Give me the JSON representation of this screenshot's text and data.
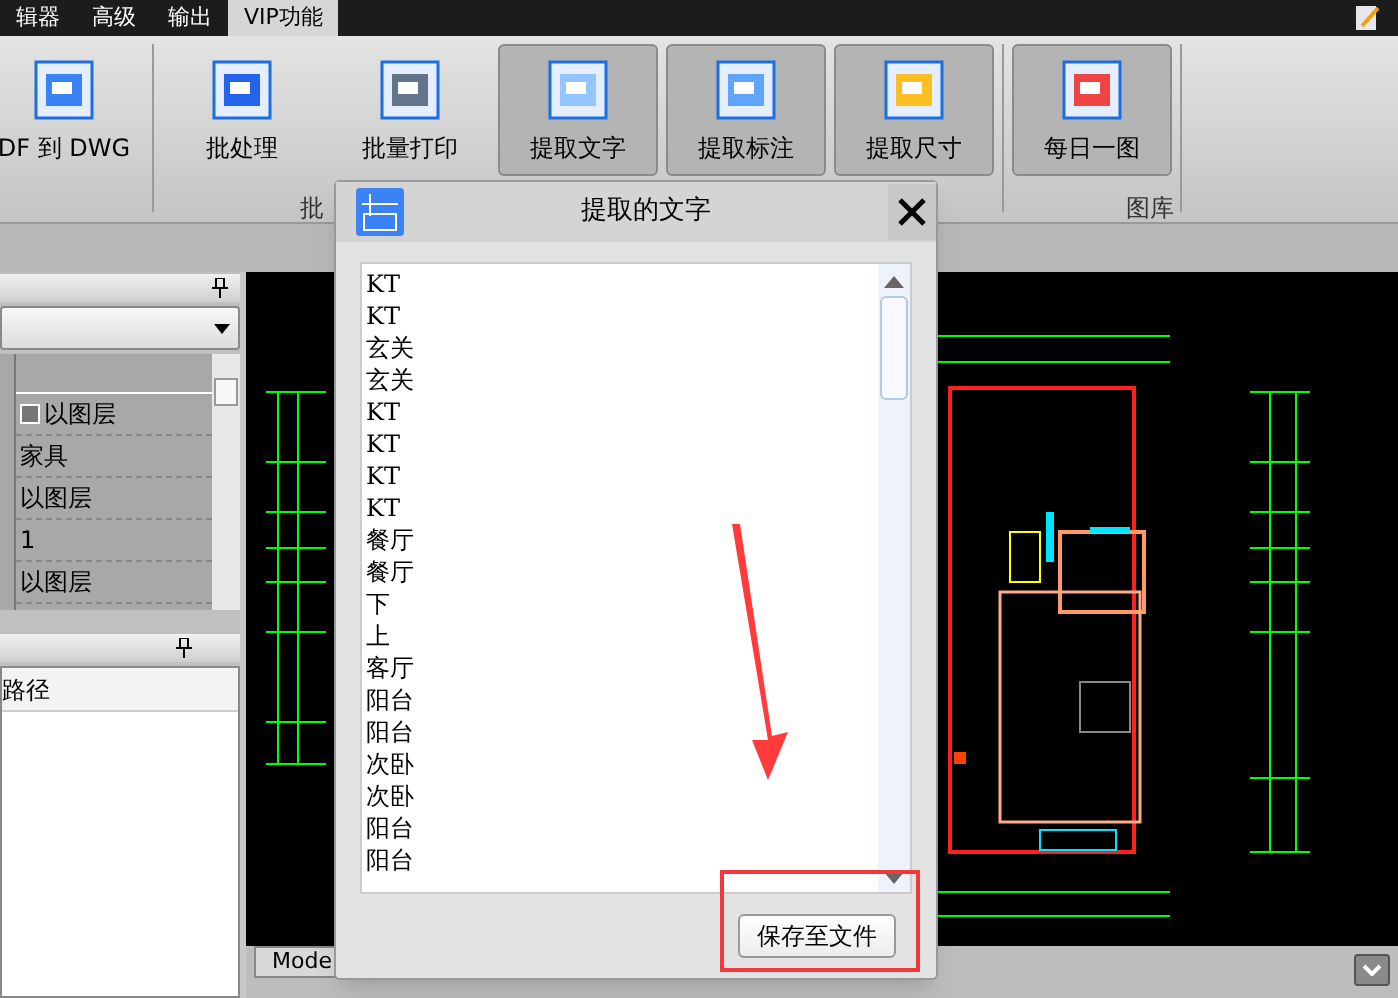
{
  "menu_tabs": [
    {
      "label": "辑器",
      "selected": false
    },
    {
      "label": "高级",
      "selected": false
    },
    {
      "label": "输出",
      "selected": false
    },
    {
      "label": "VIP功能",
      "selected": true
    }
  ],
  "ribbon": {
    "buttons": [
      {
        "label": "DF 到 DWG",
        "framed": false
      },
      {
        "label": "批处理",
        "framed": false
      },
      {
        "label": "批量打印",
        "framed": false
      },
      {
        "label": "提取文字",
        "framed": true
      },
      {
        "label": "提取标注",
        "framed": true
      },
      {
        "label": "提取尺寸",
        "framed": true
      },
      {
        "label": "每日一图",
        "framed": true
      }
    ],
    "group_labels": [
      "批",
      "图库"
    ]
  },
  "properties": {
    "rows": [
      {
        "value": "以图层",
        "swatch": true
      },
      {
        "value": "家具",
        "swatch": false
      },
      {
        "value": "以图层",
        "swatch": false
      },
      {
        "value": "1",
        "swatch": false
      },
      {
        "value": "以图层",
        "swatch": false
      }
    ]
  },
  "files_panel": {
    "column": "路径"
  },
  "layout_tab": "Mode",
  "dialog": {
    "title": "提取的文字",
    "items": [
      "KT",
      "KT",
      "玄关",
      "玄关",
      "KT",
      "KT",
      "KT",
      "KT",
      "餐厅",
      "餐厅",
      "下",
      "上",
      "客厅",
      "阳台",
      "阳台",
      "次卧",
      "次卧",
      "阳台",
      "阳台"
    ],
    "save_button": "保存至文件"
  }
}
